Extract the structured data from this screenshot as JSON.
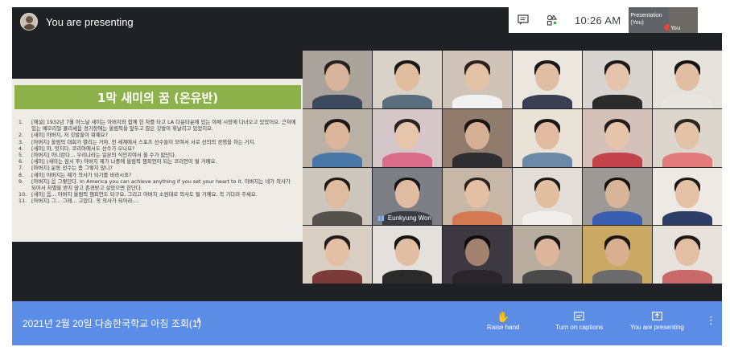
{
  "presenting": {
    "label": "You are presenting"
  },
  "top_bar": {
    "chat_icon": "chat-icon",
    "activities_icon": "activities-icon",
    "time": "10:26  AM",
    "self_presentation_label": "Presentation (You)",
    "self_you_label": "You"
  },
  "slide": {
    "title": "1막 새미의 꿈 (온유반)",
    "lines": [
      {
        "num": "1.",
        "text": "[해설] 1932년 7월 어느날 새미는 아버지와 함께 헌 차를 타고  LA 다운타운에 있는 야채 시장에 다녀오고 있었어요. 근처에 있는 메모리얼 콜리세움 경기장에는 올림픽을 앞두고 많은 깃발이 휘날리고 있었지요."
      },
      {
        "num": "2.",
        "text": "[새미] 아버지, 저 깃발들이 뭐예요?"
      },
      {
        "num": "3.",
        "text": "[아버지] 올림픽 대회가 열리는 거야. 전 세계에서 스포츠 선수들이 모여서 서로 선의의 경쟁을 하는 거지."
      },
      {
        "num": "4.",
        "text": "[새미] 와, 멋지다. 코리아에서도 선수가 오나요?"
      },
      {
        "num": "5.",
        "text": "[아버지] 아니란다... 우리나라는 일본의 식민지여서 올 수가 없단다."
      },
      {
        "num": "6.",
        "text": "[새미] (새미는 잠시 후) 아버지 제가 나중에 올림픽 챔피언이 되는 코리언이 될 거예요."
      },
      {
        "num": "7.",
        "text": "[아버지] 운동 선수는 좀 그렇지 않니?"
      },
      {
        "num": "8.",
        "text": "[새미] 아버지는 제가 의사가 되기를 바라시죠?"
      },
      {
        "num": "9.",
        "text": "[아버지] 음 그렇단다. In America you can achieve anything if you set your heart to it. 아버지는 네가 의사가 되어서 차별을 받지 않고 존경받고 살았으면 한단다."
      },
      {
        "num": "10.",
        "text": "[새미] 음... 아버지 올림픽 챔피언도 되구요, 그리고 아버지 소원대로 의사도 될 거예요. 꼭 기다려 주세요."
      },
      {
        "num": "11.",
        "text": "[아버지] 그... 그래... 고맙다. 꼭 의사가 되어라...."
      }
    ]
  },
  "participants": [
    {
      "name": "",
      "bg": "#a9a39c",
      "skin": "#d8b49a",
      "hair": "#2a211c",
      "shirt": "#3b4a5c"
    },
    {
      "name": "",
      "bg": "#d9d2c8",
      "skin": "#e1bda0",
      "hair": "#1b1715",
      "shirt": "#5a6f7d"
    },
    {
      "name": "",
      "bg": "#cfc4b7",
      "skin": "#e3c3a6",
      "hair": "#2d231d",
      "shirt": "#f1f1f1"
    },
    {
      "name": "",
      "bg": "#ece7df",
      "skin": "#e0bea4",
      "hair": "#1d1816",
      "shirt": "#3a3f52"
    },
    {
      "name": "",
      "bg": "#d8d4cf",
      "skin": "#e4c4aa",
      "hair": "#201a17",
      "shirt": "#2b2b2b"
    },
    {
      "name": "",
      "bg": "#e6e2dc",
      "skin": "#e2bfa3",
      "hair": "#161311",
      "shirt": "#e9e6e1"
    },
    {
      "name": "",
      "bg": "#b9b1a6",
      "skin": "#dcb69a",
      "hair": "#1e1916",
      "shirt": "#4a78a6"
    },
    {
      "name": "",
      "bg": "#d5c7c9",
      "skin": "#e6c5ab",
      "hair": "#2a2320",
      "shirt": "#d96c8b"
    },
    {
      "name": "",
      "bg": "#8f7c6c",
      "skin": "#d6b092",
      "hair": "#191513",
      "shirt": "#2e2e30"
    },
    {
      "name": "",
      "bg": "#e9e2d6",
      "skin": "#e0bb9f",
      "hair": "#1a1614",
      "shirt": "#6b8aa8"
    },
    {
      "name": "",
      "bg": "#d3c1ba",
      "skin": "#e6c4a9",
      "hair": "#231c19",
      "shirt": "#c4434a"
    },
    {
      "name": "",
      "bg": "#ddd6cc",
      "skin": "#e4c2a7",
      "hair": "#2d2520",
      "shirt": "#e27b7b"
    },
    {
      "name": "",
      "bg": "#cdc6bc",
      "skin": "#dfbca0",
      "hair": "#1f1a17",
      "shirt": "#55524d"
    },
    {
      "name": "Eunkyung Won",
      "bg": "#7d7f86",
      "skin": "#e0bda2",
      "hair": "#171412",
      "shirt": "#3c3c44"
    },
    {
      "name": "",
      "bg": "#c6b7a7",
      "skin": "#e3c0a3",
      "hair": "#2b221c",
      "shirt": "#d37a52"
    },
    {
      "name": "",
      "bg": "#e2ddd6",
      "skin": "#e1be9f",
      "hair": "#1d1816",
      "shirt": "#f0efec"
    },
    {
      "name": "",
      "bg": "#9d9a95",
      "skin": "#d9b598",
      "hair": "#141210",
      "shirt": "#3b5fb0"
    },
    {
      "name": "",
      "bg": "#ede9e3",
      "skin": "#e4c2a6",
      "hair": "#1b1715",
      "shirt": "#2d3e66"
    },
    {
      "name": "",
      "bg": "#d8cec2",
      "skin": "#e3bfa3",
      "hair": "#231d1a",
      "shirt": "#7c3b3b"
    },
    {
      "name": "",
      "bg": "#e4e1dc",
      "skin": "#e2bfa2",
      "hair": "#151210",
      "shirt": "#2a2a2a"
    },
    {
      "name": "",
      "bg": "#3c3a40",
      "skin": "#a3836e",
      "hair": "#0f0d0c",
      "shirt": "#28262b"
    },
    {
      "name": "",
      "bg": "#b8ad9f",
      "skin": "#dbb69a",
      "hair": "#191513",
      "shirt": "#4a4a4a"
    },
    {
      "name": "",
      "bg": "#c9a963",
      "skin": "#d8b08f",
      "hair": "#1c1714",
      "shirt": "#6b6b6b"
    },
    {
      "name": "",
      "bg": "#e7e2dc",
      "skin": "#e3c0a4",
      "hair": "#201b18",
      "shirt": "#c86a6a"
    }
  ],
  "bottom_bar": {
    "meeting_title": "2021년 2월 20일 다솜한국학교 아침 조회(1)",
    "raise_hand": "Raise hand",
    "captions": "Turn on captions",
    "presenting": "You are presenting"
  }
}
